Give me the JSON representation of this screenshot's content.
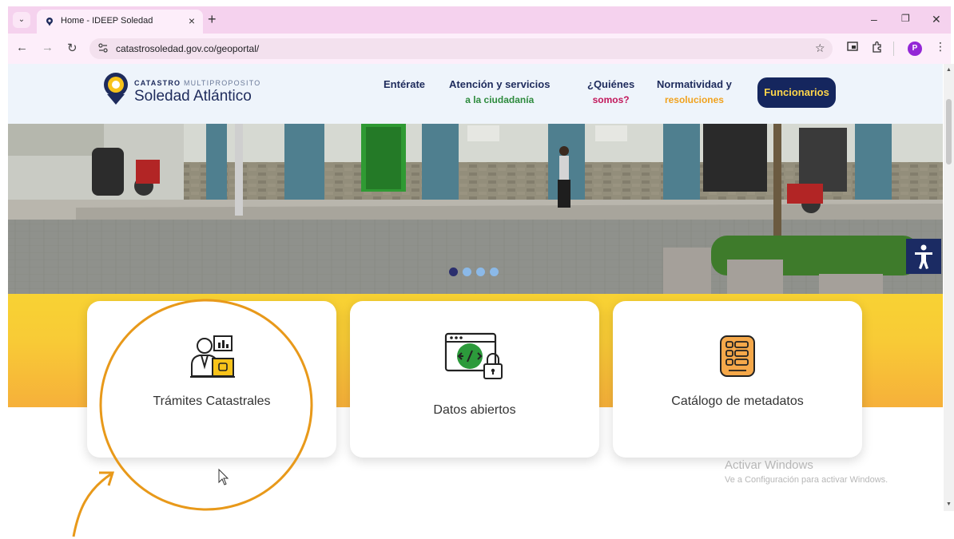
{
  "browser": {
    "tab_title": "Home - IDEEP Soledad",
    "tab_close": "×",
    "new_tab": "+",
    "url": "catastrosoledad.gov.co/geoportal/",
    "profile_initial": "P",
    "minimize": "–",
    "maximize": "❐",
    "close": "✕",
    "back": "←",
    "forward": "→",
    "reload": "↻",
    "star": "☆",
    "menu": "⋮",
    "tab_dropdown": "⌄"
  },
  "site": {
    "logo_top_bold": "CATASTRO",
    "logo_top_light": "MULTIPROPOSITO",
    "logo_bottom": "Soledad Atlántico",
    "nav": [
      {
        "label": "Entérate",
        "sub": "",
        "sub_color": ""
      },
      {
        "label": "Atención y servicios",
        "sub": "a la ciudadanía",
        "sub_color": "#2e8b3e"
      },
      {
        "label": "¿Quiénes",
        "sub": "somos?",
        "sub_color": "#c2185b"
      },
      {
        "label": "Normatividad y",
        "sub": "resoluciones",
        "sub_color": "#f0a21e"
      }
    ],
    "funcionarios": "Funcionarios",
    "carousel_slides": 4,
    "carousel_active": 1
  },
  "cards": [
    {
      "label": "Trámites Catastrales",
      "icon": "clerk-document-icon"
    },
    {
      "label": "Datos abiertos",
      "icon": "code-lock-icon"
    },
    {
      "label": "Catálogo de metadatos",
      "icon": "catalog-list-icon"
    }
  ],
  "watermark": {
    "line1": "Activar Windows",
    "line2": "Ve a Configuración para activar Windows."
  },
  "colors": {
    "brand_navy": "#15265e",
    "brand_yellow": "#f8d233",
    "annotation_orange": "#e8991a"
  }
}
